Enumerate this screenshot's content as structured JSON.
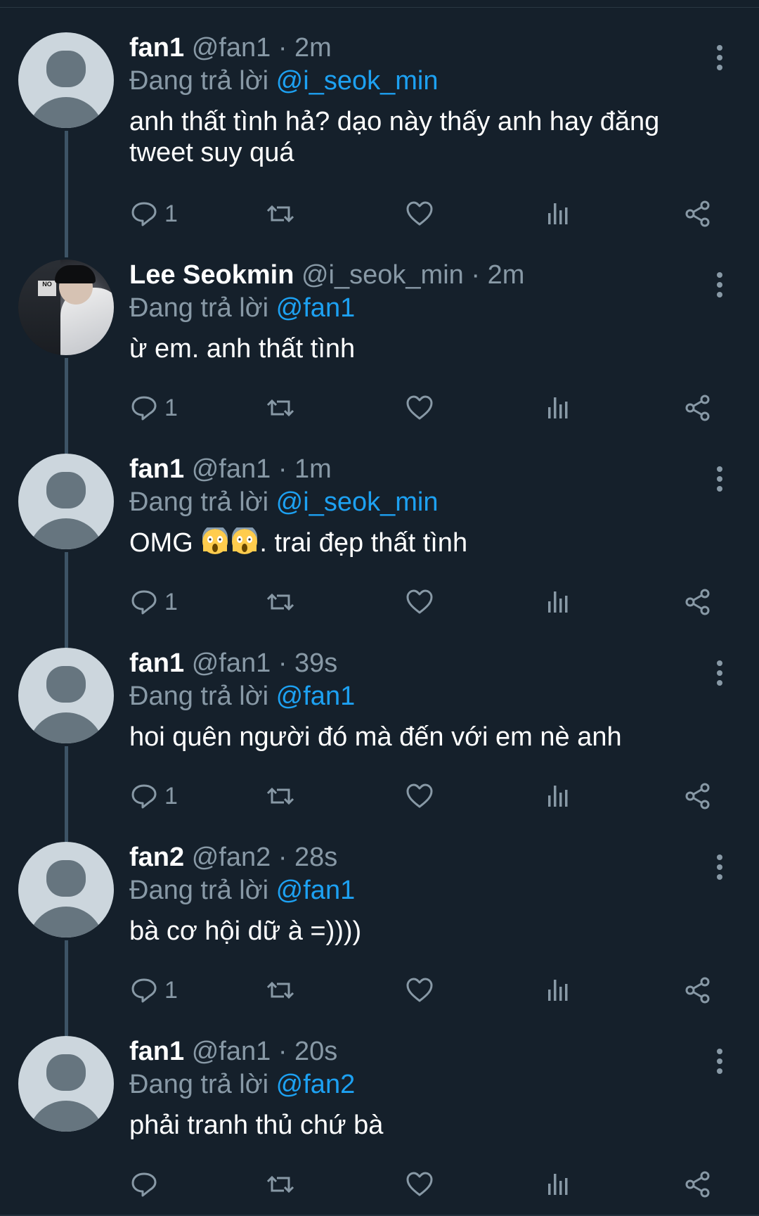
{
  "colors": {
    "background": "#15202b",
    "secondary_text": "#8899a6",
    "mention": "#1da1f2",
    "thread_line": "#3d5466",
    "default_avatar_bg": "#ccd6dd",
    "default_avatar_fg": "#66757f"
  },
  "labels": {
    "replying_to": "Đang trả lời"
  },
  "tweets": [
    {
      "name": "fan1",
      "handle": "@fan1",
      "sep": "·",
      "time": "2m",
      "reply_to": "@i_seok_min",
      "text": "anh thất tình hả? dạo này thấy anh hay đăng tweet suy quá",
      "reply_count": "1",
      "avatar": "default-avatar-icon"
    },
    {
      "name": "Lee Seokmin",
      "handle": "@i_seok_min",
      "sep": "·",
      "time": "2m",
      "reply_to": "@fan1",
      "text": "ừ em. anh thất tình",
      "reply_count": "1",
      "avatar": "profile-photo"
    },
    {
      "name": "fan1",
      "handle": "@fan1",
      "sep": "·",
      "time": "1m",
      "reply_to": "@i_seok_min",
      "text_before": "OMG ",
      "text_after": ". trai đẹp thất tình",
      "emoji": "screaming-face-icon",
      "reply_count": "1",
      "avatar": "default-avatar-icon"
    },
    {
      "name": "fan1",
      "handle": "@fan1",
      "sep": "·",
      "time": "39s",
      "reply_to": "@fan1",
      "text": "hoi quên người đó mà đến với em nè anh",
      "reply_count": "1",
      "avatar": "default-avatar-icon"
    },
    {
      "name": "fan2",
      "handle": "@fan2",
      "sep": "·",
      "time": "28s",
      "reply_to": "@fan1",
      "text": "bà cơ hội dữ à =))))",
      "reply_count": "1",
      "avatar": "default-avatar-icon"
    },
    {
      "name": "fan1",
      "handle": "@fan1",
      "sep": "·",
      "time": "20s",
      "reply_to": "@fan2",
      "text": "phải tranh thủ chứ bà",
      "reply_count": "",
      "avatar": "default-avatar-icon"
    }
  ],
  "avatar_sign_text": "NO"
}
